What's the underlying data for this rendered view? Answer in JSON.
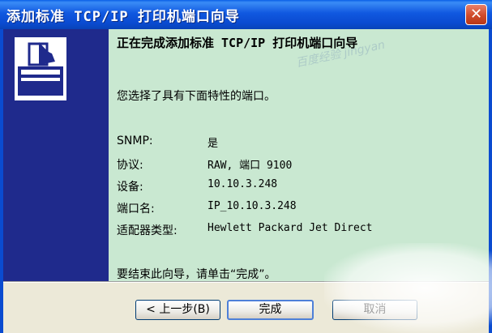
{
  "window": {
    "title": "添加标准 TCP/IP 打印机端口向导",
    "close_glyph": "✕"
  },
  "content": {
    "heading": "正在完成添加标准 TCP/IP 打印机端口向导",
    "subtitle": "您选择了具有下面特性的端口。",
    "properties": [
      {
        "key": "SNMP:",
        "value": "是"
      },
      {
        "key": "协议:",
        "value": "RAW, 端口 9100"
      },
      {
        "key": "设备:",
        "value": "10.10.3.248"
      },
      {
        "key": "端口名:",
        "value": "IP_10.10.3.248"
      },
      {
        "key": "适配器类型:",
        "value": "Hewlett Packard Jet Direct"
      }
    ],
    "finish_text": "要结束此向导，请单击“完成”。"
  },
  "buttons": {
    "back": "< 上一步(B)",
    "finish": "完成",
    "cancel": "取消"
  },
  "watermark": "百度经验 jingyan"
}
